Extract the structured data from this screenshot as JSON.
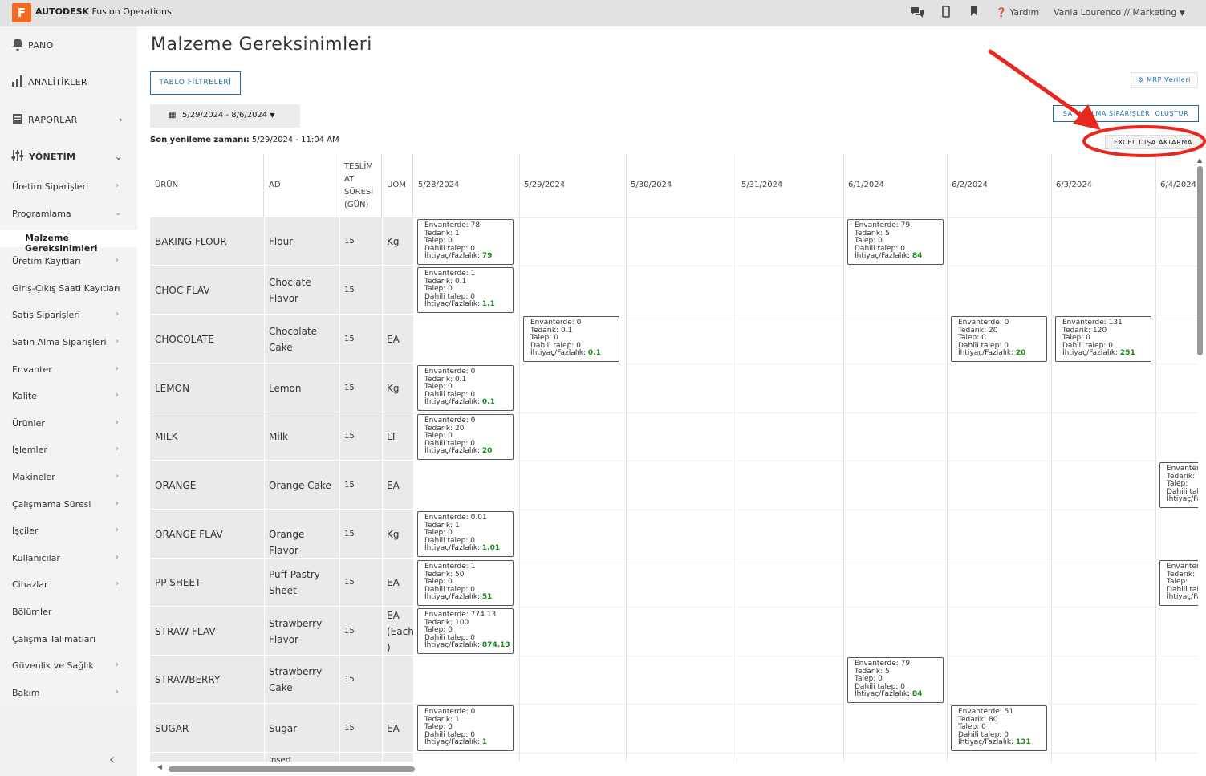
{
  "app": {
    "logo_letter": "F",
    "brand_bold": "AUTODESK",
    "brand_rest": " Fusion Operations"
  },
  "topbar": {
    "help": "Yardım",
    "user": "Vania Lourenco // Marketing"
  },
  "sidebar": {
    "main_items": [
      {
        "label": "PANO",
        "icon": "bell-icon"
      },
      {
        "label": "ANALİTİKLER",
        "icon": "bar-chart-icon"
      },
      {
        "label": "RAPORLAR",
        "icon": "report-icon"
      },
      {
        "label": "YÖNETİM",
        "icon": "sliders-icon"
      }
    ],
    "sub_items": [
      "Üretim Siparişleri",
      "Programlama",
      "Malzeme Gereksinimleri",
      "Üretim Kayıtları",
      "Giriş-Çıkış Saati Kayıtları",
      "Satış Siparişleri",
      "Satın Alma Siparişleri",
      "Envanter",
      "Kalite",
      "Ürünler",
      "İşlemler",
      "Makineler",
      "Çalışmama Süresi",
      "İşçiler",
      "Kullanıcılar",
      "Cihazlar",
      "Bölümler",
      "Çalışma Talimatları",
      "Güvenlik ve Sağlık",
      "Bakım"
    ]
  },
  "page": {
    "title": "Malzeme Gereksinimleri",
    "filters_button": "TABLO FİLTRELERİ",
    "mrp_button": "MRP Verileri",
    "create_po_button": "SATIN ALMA SİPARİŞLERİ OLUŞTUR",
    "date_range": "5/29/2024 - 8/6/2024",
    "refresh_label": "Son yenileme zamanı:",
    "refresh_value": "5/29/2024 - 11:04 AM",
    "excel_button": "EXCEL DIŞA AKTARMA"
  },
  "table": {
    "headers": {
      "product": "ÜRÜN",
      "name": "AD",
      "lead": "TESLİM AT SÜRESİ (GÜN)",
      "uom": "UOM"
    },
    "dates": [
      "5/28/2024",
      "5/29/2024",
      "5/30/2024",
      "5/31/2024",
      "6/1/2024",
      "6/2/2024",
      "6/3/2024",
      "6/4/2024"
    ],
    "rows": [
      {
        "product": "BAKING FLOUR",
        "name": "Flour",
        "lead": "15",
        "uom": "Kg"
      },
      {
        "product": "CHOC FLAV",
        "name": "Choclate Flavor",
        "lead": "15",
        "uom": ""
      },
      {
        "product": "CHOCOLATE",
        "name": "Chocolate Cake",
        "lead": "15",
        "uom": "EA"
      },
      {
        "product": "LEMON",
        "name": "Lemon",
        "lead": "15",
        "uom": "Kg"
      },
      {
        "product": "MILK",
        "name": "Milk",
        "lead": "15",
        "uom": "LT"
      },
      {
        "product": "ORANGE",
        "name": "Orange Cake",
        "lead": "15",
        "uom": "EA"
      },
      {
        "product": "ORANGE FLAV",
        "name": "Orange Flavor",
        "lead": "15",
        "uom": "Kg"
      },
      {
        "product": "PP SHEET",
        "name": "Puff Pastry Sheet",
        "lead": "15",
        "uom": "EA"
      },
      {
        "product": "STRAW FLAV",
        "name": "Strawberry Flavor",
        "lead": "15",
        "uom": "EA (Each )"
      },
      {
        "product": "STRAWBERRY",
        "name": "Strawberry Cake",
        "lead": "15",
        "uom": ""
      },
      {
        "product": "SUGAR",
        "name": "Sugar",
        "lead": "15",
        "uom": "EA"
      },
      {
        "product": "",
        "name": "Insert",
        "lead": "",
        "uom": ""
      }
    ],
    "labels": {
      "inv": "Envanterde:",
      "sup": "Tedarik:",
      "dem": "Talep:",
      "int": "Dahili talep:",
      "net": "İhtiyaç/Fazlalık:"
    },
    "cards": [
      {
        "row": 0,
        "col": 0,
        "inv": "78",
        "sup": "1",
        "dem": "0",
        "int": "0",
        "net": "79"
      },
      {
        "row": 0,
        "col": 4,
        "inv": "79",
        "sup": "5",
        "dem": "0",
        "int": "0",
        "net": "84"
      },
      {
        "row": 1,
        "col": 0,
        "inv": "1",
        "sup": "0.1",
        "dem": "0",
        "int": "0",
        "net": "1.1"
      },
      {
        "row": 2,
        "col": 1,
        "inv": "0",
        "sup": "0.1",
        "dem": "0",
        "int": "0",
        "net": "0.1"
      },
      {
        "row": 2,
        "col": 5,
        "inv": "0",
        "sup": "20",
        "dem": "0",
        "int": "0",
        "net": "20"
      },
      {
        "row": 2,
        "col": 6,
        "inv": "131",
        "sup": "120",
        "dem": "0",
        "int": "0",
        "net": "251"
      },
      {
        "row": 3,
        "col": 0,
        "inv": "0",
        "sup": "0.1",
        "dem": "0",
        "int": "0",
        "net": "0.1"
      },
      {
        "row": 4,
        "col": 0,
        "inv": "0",
        "sup": "20",
        "dem": "0",
        "int": "0",
        "net": "20"
      },
      {
        "row": 5,
        "col": 7,
        "inv": "",
        "sup": "",
        "dem": "",
        "int": "",
        "net": ""
      },
      {
        "row": 6,
        "col": 0,
        "inv": "0.01",
        "sup": "1",
        "dem": "0",
        "int": "0",
        "net": "1.01"
      },
      {
        "row": 7,
        "col": 0,
        "inv": "1",
        "sup": "50",
        "dem": "0",
        "int": "0",
        "net": "51"
      },
      {
        "row": 7,
        "col": 7,
        "inv": "",
        "sup": "",
        "dem": "",
        "int": "",
        "net": ""
      },
      {
        "row": 8,
        "col": 0,
        "inv": "774.13",
        "sup": "100",
        "dem": "0",
        "int": "0",
        "net": "874.13"
      },
      {
        "row": 9,
        "col": 4,
        "inv": "79",
        "sup": "5",
        "dem": "0",
        "int": "0",
        "net": "84"
      },
      {
        "row": 10,
        "col": 0,
        "inv": "0",
        "sup": "1",
        "dem": "0",
        "int": "0",
        "net": "1"
      },
      {
        "row": 10,
        "col": 5,
        "inv": "51",
        "sup": "80",
        "dem": "0",
        "int": "0",
        "net": "131"
      }
    ]
  },
  "colors": {
    "accent": "#1e6fa8",
    "annotation": "#e8281e",
    "positive": "#1a8a1a"
  }
}
